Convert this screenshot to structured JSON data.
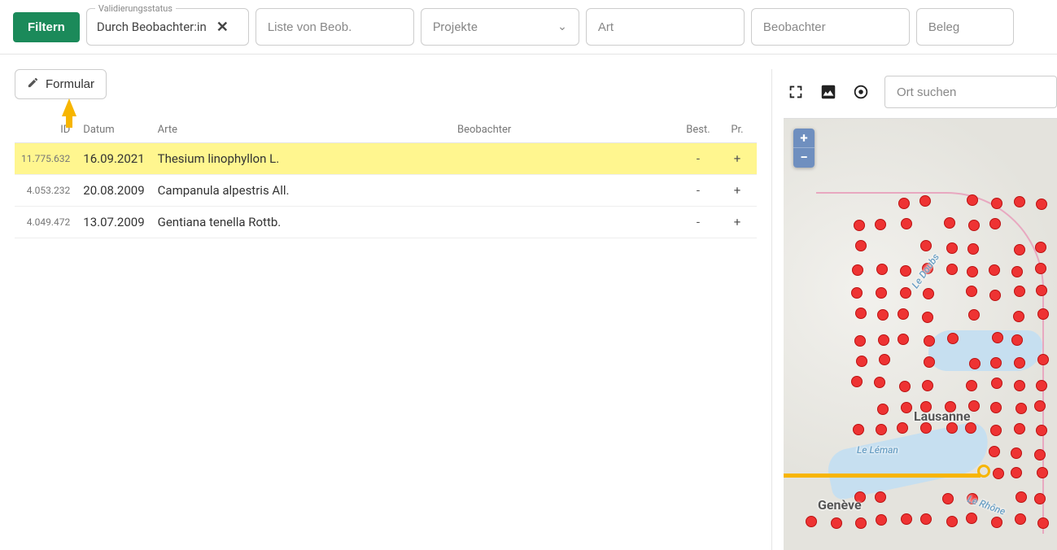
{
  "filter_bar": {
    "filter_button": "Filtern",
    "validation": {
      "label": "Validierungsstatus",
      "value": "Durch Beobachter:in"
    },
    "list_placeholder": "Liste von Beob.",
    "projects_placeholder": "Projekte",
    "species_placeholder": "Art",
    "observer_placeholder": "Beobachter",
    "voucher_placeholder": "Beleg"
  },
  "left": {
    "formular_button": "Formular",
    "columns": {
      "id": "ID",
      "date": "Datum",
      "species": "Arte",
      "observer": "Beobachter",
      "best": "Best.",
      "pr": "Pr."
    },
    "rows": [
      {
        "id": "11.775.632",
        "date": "16.09.2021",
        "species": "Thesium linophyllon L.",
        "best": "-",
        "pr": "+",
        "highlight": true
      },
      {
        "id": "4.053.232",
        "date": "20.08.2009",
        "species": "Campanula alpestris All.",
        "best": "-",
        "pr": "+",
        "highlight": false
      },
      {
        "id": "4.049.472",
        "date": "13.07.2009",
        "species": "Gentiana tenella Rottb.",
        "best": "-",
        "pr": "+",
        "highlight": false
      }
    ]
  },
  "map": {
    "search_placeholder": "Ort suchen",
    "zoom_in": "+",
    "zoom_out": "−",
    "labels": {
      "lausanne": "Lausanne",
      "geneve": "Genève",
      "leman": "Le Léman",
      "doubs": "Le Doubs",
      "rhone": "Le Rhône"
    }
  }
}
